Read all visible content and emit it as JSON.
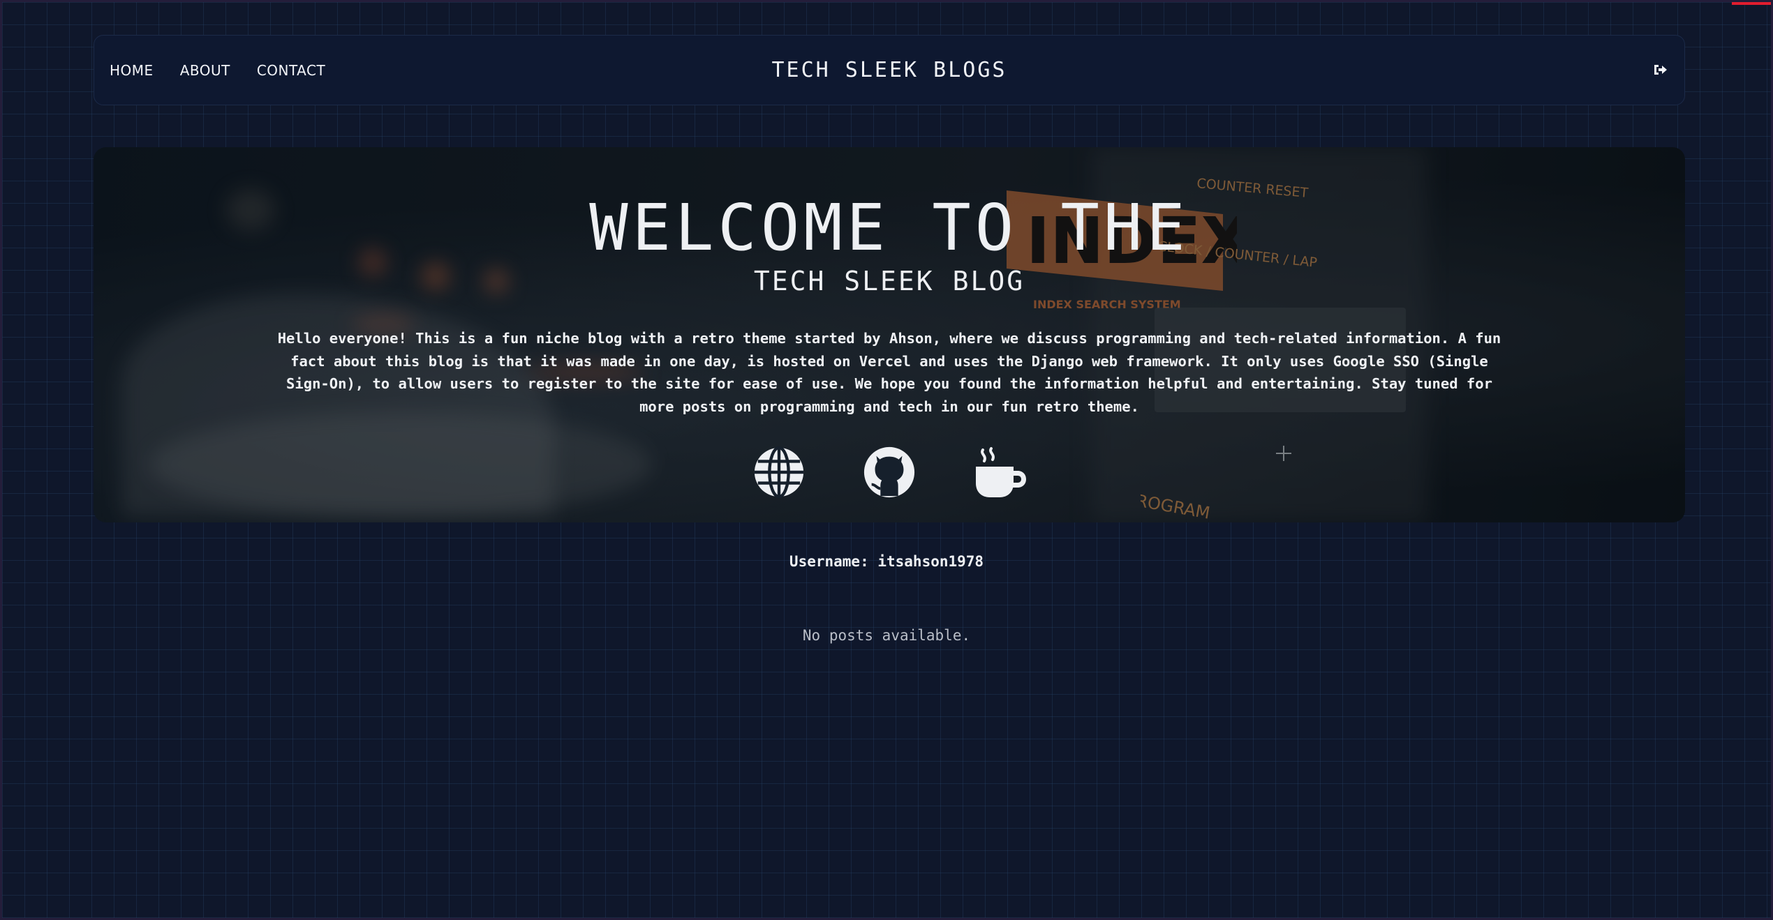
{
  "nav": {
    "links": [
      "HOME",
      "ABOUT",
      "CONTACT"
    ],
    "brand": "TECH SLEEK BLOGS",
    "logout_icon": "sign-out-icon"
  },
  "hero": {
    "title": "WELCOME TO THE",
    "subtitle": "TECH SLEEK BLOG",
    "description": "Hello everyone! This is a fun niche blog with a retro theme started by Ahson, where we discuss programming and tech-related information. A fun fact about this blog is that it was made in one day, is hosted on Vercel and uses the Django web framework. It only uses Google SSO (Single Sign-On), to allow users to register to the site for ease of use. We hope you found the information helpful and entertaining. Stay tuned for more posts on programming and tech in our fun retro theme.",
    "icons": [
      "globe-icon",
      "github-icon",
      "coffee-icon"
    ],
    "background_labels": {
      "counter_reset": "COUNTER RESET",
      "clock": "CLOCK / COUNTER / LAP",
      "index": "INDEX",
      "index_system": "INDEX SEARCH SYSTEM",
      "tv_program": "TV PROGRAM"
    }
  },
  "profile": {
    "username_label": "Username: itsahson1978"
  },
  "posts": {
    "empty_message": "No posts available."
  },
  "colors": {
    "background": "#0f172b",
    "accent_red": "#e11d2e",
    "index_orange": "#d9773a"
  }
}
